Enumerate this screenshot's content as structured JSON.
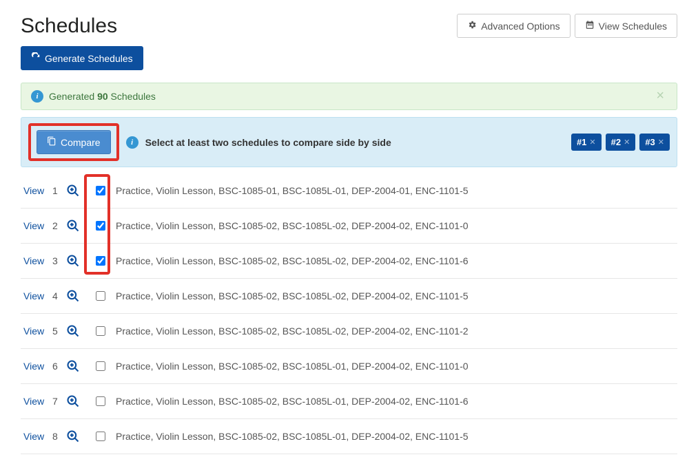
{
  "header": {
    "title": "Schedules",
    "advanced_options": "Advanced Options",
    "view_schedules": "View Schedules"
  },
  "actions": {
    "generate": "Generate Schedules",
    "compare": "Compare"
  },
  "alert": {
    "prefix": "Generated",
    "count": "90",
    "suffix": "Schedules"
  },
  "instruction": "Select at least two schedules to compare side by side",
  "badges": [
    "#1",
    "#2",
    "#3"
  ],
  "view_label": "View",
  "schedules": [
    {
      "n": "1",
      "checked": true,
      "desc": "Practice, Violin Lesson, BSC-1085-01, BSC-1085L-01, DEP-2004-01, ENC-1101-5"
    },
    {
      "n": "2",
      "checked": true,
      "desc": "Practice, Violin Lesson, BSC-1085-02, BSC-1085L-02, DEP-2004-02, ENC-1101-0"
    },
    {
      "n": "3",
      "checked": true,
      "desc": "Practice, Violin Lesson, BSC-1085-02, BSC-1085L-02, DEP-2004-02, ENC-1101-6"
    },
    {
      "n": "4",
      "checked": false,
      "desc": "Practice, Violin Lesson, BSC-1085-02, BSC-1085L-02, DEP-2004-02, ENC-1101-5"
    },
    {
      "n": "5",
      "checked": false,
      "desc": "Practice, Violin Lesson, BSC-1085-02, BSC-1085L-02, DEP-2004-02, ENC-1101-2"
    },
    {
      "n": "6",
      "checked": false,
      "desc": "Practice, Violin Lesson, BSC-1085-02, BSC-1085L-01, DEP-2004-02, ENC-1101-0"
    },
    {
      "n": "7",
      "checked": false,
      "desc": "Practice, Violin Lesson, BSC-1085-02, BSC-1085L-01, DEP-2004-02, ENC-1101-6"
    },
    {
      "n": "8",
      "checked": false,
      "desc": "Practice, Violin Lesson, BSC-1085-02, BSC-1085L-01, DEP-2004-02, ENC-1101-5"
    }
  ]
}
